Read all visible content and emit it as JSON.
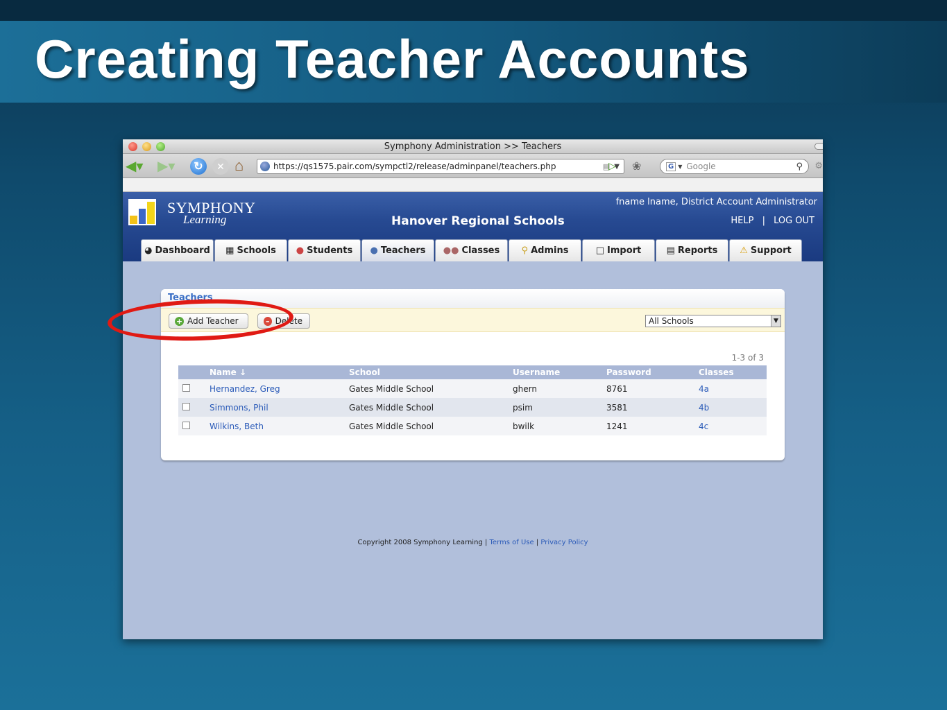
{
  "slide": {
    "title": "Creating Teacher Accounts"
  },
  "browser": {
    "window_title": "Symphony Administration >> Teachers",
    "url": "https://qs1575.pair.com/sympctl2/release/adminpanel/teachers.php",
    "search_placeholder": "Google"
  },
  "header": {
    "logo_name": "SYMPHONY",
    "logo_sub": "Learning",
    "org_name": "Hanover Regional Schools",
    "user_info": "fname lname, District Account Administrator",
    "help_label": "HELP",
    "separator": "|",
    "logout_label": "LOG OUT"
  },
  "tabs": [
    {
      "label": "Dashboard",
      "icon": "gauge-icon"
    },
    {
      "label": "Schools",
      "icon": "building-icon"
    },
    {
      "label": "Students",
      "icon": "student-icon"
    },
    {
      "label": "Teachers",
      "icon": "teacher-icon",
      "active": true
    },
    {
      "label": "Classes",
      "icon": "group-icon"
    },
    {
      "label": "Admins",
      "icon": "key-icon"
    },
    {
      "label": "Import",
      "icon": "document-add-icon"
    },
    {
      "label": "Reports",
      "icon": "report-icon"
    },
    {
      "label": "Support",
      "icon": "warning-icon"
    }
  ],
  "panel": {
    "title": "Teachers",
    "add_button": "Add Teacher",
    "delete_button": "Delete",
    "school_filter": "All Schools",
    "count_text": "1-3 of 3"
  },
  "table": {
    "columns": [
      "Name ↓",
      "School",
      "Username",
      "Password",
      "Classes"
    ],
    "rows": [
      {
        "name": "Hernandez, Greg",
        "school": "Gates Middle School",
        "username": "ghern",
        "password": "8761",
        "classes": "4a"
      },
      {
        "name": "Simmons, Phil",
        "school": "Gates Middle School",
        "username": "psim",
        "password": "3581",
        "classes": "4b"
      },
      {
        "name": "Wilkins, Beth",
        "school": "Gates Middle School",
        "username": "bwilk",
        "password": "1241",
        "classes": "4c"
      }
    ]
  },
  "footer": {
    "copyright": "Copyright 2008 Symphony Learning |",
    "terms": "Terms of Use",
    "separator": "|",
    "privacy": "Privacy Policy"
  },
  "colors": {
    "header_blue": "#274a92",
    "link_blue": "#2a5ab8",
    "highlight_red": "#e01a14",
    "content_bg": "#b1bfdb"
  }
}
